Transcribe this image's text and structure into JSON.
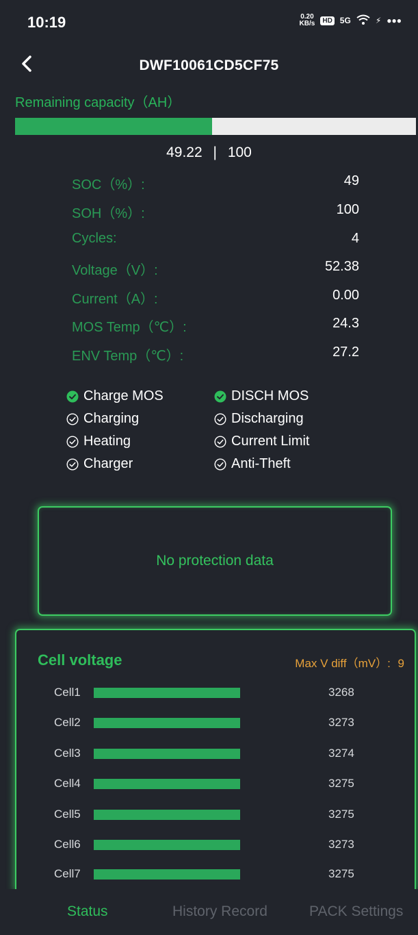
{
  "status_bar": {
    "time": "10:19",
    "net_speed_top": "0.20",
    "net_speed_bottom": "KB/s",
    "hd": "HD",
    "signal": "5G",
    "wifi_icon": "wifi-icon",
    "charge_icon": "charging-bolt-icon"
  },
  "header": {
    "back_icon": "chevron-left-icon",
    "title": "DWF10061CD5CF75"
  },
  "capacity": {
    "label": "Remaining capacity（AH）",
    "remaining": "49.22",
    "separator": "|",
    "total": "100",
    "fill_fraction": 0.4922
  },
  "metrics": [
    {
      "label": "SOC（%）:",
      "value": "49"
    },
    {
      "label": "SOH（%）:",
      "value": "100"
    },
    {
      "label": "Cycles:",
      "value": "4"
    },
    {
      "label": "Voltage（V）:",
      "value": "52.38"
    },
    {
      "label": "Current（A）:",
      "value": "0.00"
    },
    {
      "label": "MOS Temp（℃）:",
      "value": "24.3"
    },
    {
      "label": "ENV Temp（℃）:",
      "value": "27.2"
    }
  ],
  "flags": [
    {
      "label": "Charge MOS",
      "active": true
    },
    {
      "label": "DISCH MOS",
      "active": true
    },
    {
      "label": "Charging",
      "active": false
    },
    {
      "label": "Discharging",
      "active": false
    },
    {
      "label": "Heating",
      "active": false
    },
    {
      "label": "Current Limit",
      "active": false
    },
    {
      "label": "Charger",
      "active": false
    },
    {
      "label": "Anti-Theft",
      "active": false
    }
  ],
  "protection": {
    "message": "No protection data"
  },
  "cell_voltage": {
    "title": "Cell voltage",
    "max_diff_label": "Max V diff（mV）:",
    "max_diff_value": "9",
    "cells": [
      {
        "label": "Cell1",
        "value": "3268"
      },
      {
        "label": "Cell2",
        "value": "3273"
      },
      {
        "label": "Cell3",
        "value": "3274"
      },
      {
        "label": "Cell4",
        "value": "3275"
      },
      {
        "label": "Cell5",
        "value": "3275"
      },
      {
        "label": "Cell6",
        "value": "3273"
      },
      {
        "label": "Cell7",
        "value": "3275"
      }
    ]
  },
  "nav": {
    "status": "Status",
    "history": "History Record",
    "pack": "PACK Settings"
  },
  "colors": {
    "background": "#22252c",
    "accent_green": "#2aa85a",
    "label_green": "#2a9a55",
    "warning_orange": "#e8a23a"
  }
}
